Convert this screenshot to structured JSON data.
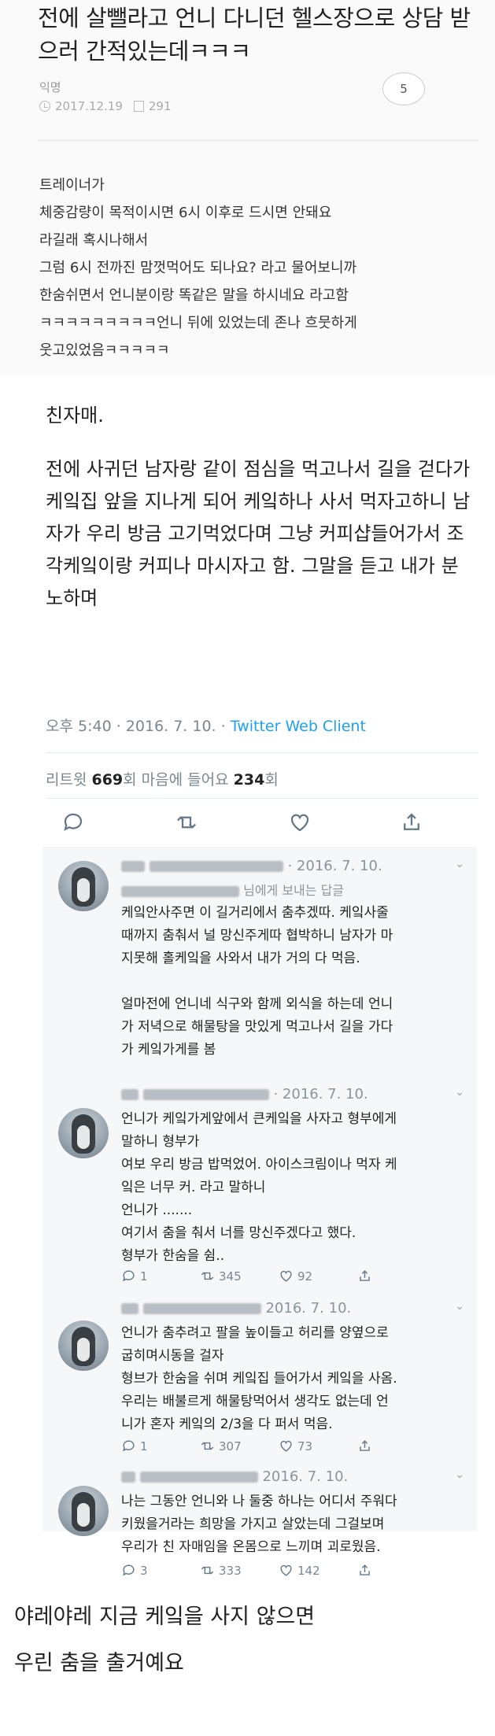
{
  "post": {
    "title": "전에 살뺄라고 언니 다니던 헬스장으로 상담 받으러 간적있는데ㅋㅋㅋ",
    "author": "익명",
    "date": "2017.12.19",
    "views": "291",
    "comment_count": "5",
    "body_lines": [
      "트레이너가",
      "체중감량이 목적이시면 6시 이후로 드시면 안돼요",
      "라길래 혹시나해서",
      "그럼 6시 전까진 맘껏먹어도 되나요? 라고 물어보니까",
      "한숨쉬면서 언니분이랑 똑같은 말을 하시네요 라고함",
      "ㅋㅋㅋㅋㅋㅋㅋㅋㅋ언니 뒤에 있었는데 존나 흐뭇하게",
      "웃고있었음ㅋㅋㅋㅋㅋ"
    ]
  },
  "tweet": {
    "paragraphs": [
      "친자매.",
      "전에 사귀던 남자랑 같이 점심을 먹고나서 길을 걷다가 케잌집 앞을 지나게 되어 케잌하나 사서 먹자고하니 남자가 우리 방금 고기먹었다며 그냥 커피샵들어가서 조각케잌이랑 커피나 마시자고 함. 그말을 듣고 내가 분노하며"
    ],
    "time": "오후 5:40 · 2016. 7. 10. · ",
    "client": "Twitter Web Client",
    "retweets_label": "리트윗 ",
    "retweets": "669",
    "retweets_unit": "회  마음에 들어요 ",
    "likes": "234",
    "likes_unit": "회"
  },
  "replies": [
    {
      "date": "· 2016. 7. 10.",
      "reply_to": "님에게 보내는 답글",
      "body": [
        "케잌안사주면 이 길거리에서 춤추겠따. 케잌사줄",
        "때까지 춤춰서 널 망신주게따 협박하니 남자가 마",
        "지못해 홀케잌을 사와서 내가 거의 다 먹음.",
        "",
        "얼마전에 언니네 식구와 함께 외식을 하는데 언니",
        "가 저녁으로 해물탕을 맛있게 먹고나서 길을 가다",
        "가 케잌가게를 봄"
      ]
    },
    {
      "date": "· 2016. 7. 10.",
      "body": [
        "언니가 케잌가게앞에서 큰케잌을 사자고 형부에게",
        "말하니 형부가",
        "여보 우리 방금 밥먹었어. 아이스크림이나 먹자 케",
        "잌은 너무 커. 라고 말하니",
        "언니가 .......",
        "여기서 춤을 춰서 너를 망신주겠다고 했다.",
        "형부가 한숨을 쉼.."
      ],
      "replies": "1",
      "retweets": "345",
      "likes": "92"
    },
    {
      "date": "2016. 7. 10.",
      "body": [
        "언니가 춤추려고  팔을 높이들고 허리를 양옆으로",
        "굽히며시동을 걸자",
        "형브가 한숨을 쉬며 케잌집 들어가서 케잌을 사옴.",
        "우리는 배불르게 해물탕먹어서 생각도 없는데 언",
        "니가 혼자 케잌의 2/3을 다 퍼서 먹음."
      ],
      "replies": "1",
      "retweets": "307",
      "likes": "73"
    },
    {
      "date": "2016. 7. 10.",
      "body": [
        "나는 그동안 언니와 나 둘중 하나는 어디서 주워다",
        "키웠을거라는 희망을 가지고 살았는데  그걸보며",
        "우리가 친 자매임을 온몸으로 느끼며 괴로웠음."
      ],
      "replies": "3",
      "retweets": "333",
      "likes": "142"
    }
  ],
  "caption": {
    "line1": "야레야레 지금 케잌을 사지 않으면",
    "line2": "우린 춤을 출거예요"
  },
  "icons": {
    "reply": "reply-icon",
    "retweet": "retweet-icon",
    "like": "heart-icon",
    "share": "share-icon"
  },
  "colors": {
    "twitter_blue": "#1da1f2",
    "meta_gray": "#7a8791"
  }
}
